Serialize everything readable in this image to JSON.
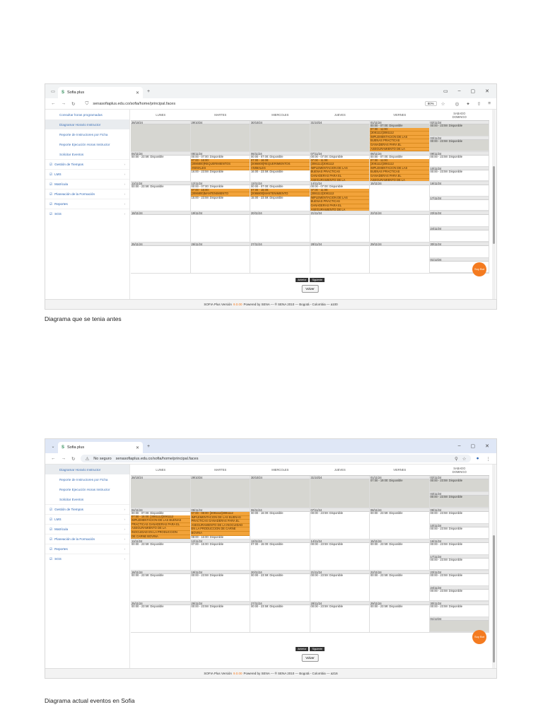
{
  "shot1": {
    "tab_title": "Sofia plus",
    "url": "senasofiaplus.edu.co/sofia/home/principal.faces",
    "zoom": "80%",
    "sidebar_sub": [
      "Consultar horas programadas",
      "Diagramar Horario Instructor",
      "Reporte de Instructores por Ficha",
      "Reporte Ejecución Horas Instructor",
      "Solicitar Eventos"
    ],
    "sidebar_main": [
      "Gestión de Tiempos",
      "LMS",
      "Matrícula",
      "Planeación de la Formación",
      "Reportes",
      "SGS"
    ],
    "headers": [
      "LUNES",
      "MARTES",
      "MIERCOLES",
      "JUEVES",
      "VIERNES",
      "SABADO",
      "DOMINGO"
    ],
    "weeks": [
      {
        "days": [
          {
            "date": "28/10/24",
            "past": true,
            "events": []
          },
          {
            "date": "29/10/24",
            "past": true,
            "events": []
          },
          {
            "date": "30/10/24",
            "past": true,
            "events": []
          },
          {
            "date": "31/10/24",
            "past": true,
            "events": []
          },
          {
            "date": "01/11/24",
            "past": true,
            "events": [
              {
                "t": "00:00 - 07:00: Disponible",
                "o": false
              },
              {
                "t": "07:00 - 11:00:",
                "o": true
              },
              {
                "t": "[3081112]3081112",
                "o": true
              },
              {
                "t": "IMPLEMENTACION DE LAS",
                "o": true
              },
              {
                "t": "BUENAS PRACTICAS",
                "o": true
              },
              {
                "t": "GANADERAS PARA EL",
                "o": true
              },
              {
                "t": "ASEGURAMIENTO DE LA",
                "o": true
              }
            ]
          },
          {
            "sat": {
              "date": "02/11/24",
              "past": true,
              "events": [
                {
                  "t": "00:00 - 23:59: Disponible",
                  "o": false
                }
              ]
            },
            "sun": {
              "date": "03/11/24",
              "past": true,
              "events": [
                {
                  "t": "00:00 - 23:59: Disponible",
                  "o": false
                }
              ]
            }
          }
        ]
      },
      {
        "days": [
          {
            "date": "04/11/24",
            "events": [
              {
                "t": "00:00 - 23:59: Disponible",
                "o": false
              }
            ]
          },
          {
            "date": "05/11/24",
            "events": [
              {
                "t": "00:00 - 07:00: Disponible",
                "o": false
              },
              {
                "t": "07:00 - 16:00:",
                "o": true
              },
              {
                "t": "[3086800]REQUERIMIENTOS",
                "o": true
              },
              {
                "t": "ANIMALES",
                "o": true
              },
              {
                "t": "16:00 - 23:59: Disponible",
                "o": false
              }
            ]
          },
          {
            "date": "06/11/24",
            "events": [
              {
                "t": "00:00 - 07:00: Disponible",
                "o": false
              },
              {
                "t": "07:00 - 16:00:",
                "o": true
              },
              {
                "t": "[3086800]REQUERIMIENTOS",
                "o": true
              },
              {
                "t": "ANIMALES",
                "o": true
              },
              {
                "t": "16:00 - 23:59: Disponible",
                "o": false
              }
            ]
          },
          {
            "date": "07/11/24",
            "events": [
              {
                "t": "00:00 - 07:00: Disponible",
                "o": false
              },
              {
                "t": "07:00 - 11:00:",
                "o": true
              },
              {
                "t": "[3081112]3081112",
                "o": true
              },
              {
                "t": "IMPLEMENTACION DE LAS",
                "o": true
              },
              {
                "t": "BUENAS PRACTICAS",
                "o": true
              },
              {
                "t": "GANADERAS PARA EL",
                "o": true
              },
              {
                "t": "ASEGURAMIENTO DE LA",
                "o": true
              }
            ]
          },
          {
            "date": "08/11/24",
            "events": [
              {
                "t": "00:00 - 07:00: Disponible",
                "o": false
              },
              {
                "t": "07:00 - 11:00:",
                "o": true
              },
              {
                "t": "[3081112]3081112",
                "o": true
              },
              {
                "t": "IMPLEMENTACION DE LAS",
                "o": true
              },
              {
                "t": "BUENAS PRACTICAS",
                "o": true
              },
              {
                "t": "GANADERAS PARA EL",
                "o": true
              },
              {
                "t": "ASEGURAMIENTO DE LA",
                "o": true
              }
            ]
          },
          {
            "sat": {
              "date": "09/11/24",
              "events": [
                {
                  "t": "00:00 - 23:59: Disponible",
                  "o": false
                }
              ]
            },
            "sun": {
              "date": "10/11/24",
              "events": [
                {
                  "t": "00:00 - 23:59: Disponible",
                  "o": false
                }
              ]
            }
          }
        ]
      },
      {
        "days": [
          {
            "date": "11/11/24",
            "events": [
              {
                "t": "00:00 - 23:59: Disponible",
                "o": false
              }
            ]
          },
          {
            "date": "12/11/24",
            "events": [
              {
                "t": "00:00 - 07:00: Disponible",
                "o": false
              },
              {
                "t": "07:00 - 15:00:",
                "o": true
              },
              {
                "t": "[3086800]MANTENIMIENTO",
                "o": true
              },
              {
                "t": "15:00 - 23:59: Disponible",
                "o": false
              }
            ]
          },
          {
            "date": "13/11/24",
            "events": [
              {
                "t": "00:00 - 07:00: Disponible",
                "o": false
              },
              {
                "t": "07:00 - 15:00:",
                "o": true
              },
              {
                "t": "[3086800]MANTENIMIENTO",
                "o": true
              },
              {
                "t": "15:00 - 23:59: Disponible",
                "o": false
              }
            ]
          },
          {
            "date": "14/11/24",
            "events": [
              {
                "t": "00:00 - 07:00: Disponible",
                "o": false
              },
              {
                "t": "07:00 - 11:00:",
                "o": true
              },
              {
                "t": "[3081112]3081112",
                "o": true
              },
              {
                "t": "IMPLEMENTACION DE LAS",
                "o": true
              },
              {
                "t": "BUENAS PRACTICAS",
                "o": true
              },
              {
                "t": "GANADERAS PARA EL",
                "o": true
              },
              {
                "t": "ASEGURAMIENTO DE LA",
                "o": true
              }
            ]
          },
          {
            "date": "15/11/24",
            "events": []
          },
          {
            "sat": {
              "date": "16/11/24",
              "events": []
            },
            "sun": {
              "date": "17/11/24",
              "events": []
            }
          }
        ]
      },
      {
        "days": [
          {
            "date": "18/11/24",
            "events": []
          },
          {
            "date": "19/11/24",
            "events": []
          },
          {
            "date": "20/11/24",
            "events": []
          },
          {
            "date": "21/11/24",
            "events": []
          },
          {
            "date": "22/11/24",
            "events": []
          },
          {
            "sat": {
              "date": "23/11/24",
              "events": []
            },
            "sun": {
              "date": "24/11/24",
              "events": []
            }
          }
        ]
      },
      {
        "days": [
          {
            "date": "25/11/24",
            "events": []
          },
          {
            "date": "26/11/24",
            "events": []
          },
          {
            "date": "27/11/24",
            "events": []
          },
          {
            "date": "28/11/24",
            "events": []
          },
          {
            "date": "29/11/24",
            "events": []
          },
          {
            "sat": {
              "date": "30/11/24",
              "events": []
            },
            "sun": {
              "date": "01/12/24",
              "events": []
            }
          }
        ]
      }
    ],
    "pager_prev": "Anterior",
    "pager_next": "Siguiente",
    "volver": "Volver",
    "chatbot": "Soy Bot",
    "footer_sofia": "SOFIA Plus Versión",
    "footer_ver": "9.0.00",
    "footer_rest": "Powered by SENA --- ® SENA 2010 --- Bogotá - Colombia --- a100"
  },
  "shot2": {
    "tab_title": "Sofia plus",
    "security": "No seguro",
    "url": "senasofiaplus.edu.co/sofia/home/principal.faces",
    "sidebar_sub": [
      "Diagramar Horario Instructor",
      "Reporte de Instructores por Ficha",
      "Reporte Ejecución Horas Instructor",
      "Solicitar Eventos"
    ],
    "sidebar_main": [
      "Gestión de Tiempos",
      "LMS",
      "Matrícula",
      "Planeación de la Formación",
      "Reportes",
      "SGS"
    ],
    "headers": [
      "LUNES",
      "MARTES",
      "MIERCOLES",
      "JUEVES",
      "VIERNES",
      "SABADO",
      "DOMINGO"
    ],
    "weeks": [
      {
        "days": [
          {
            "date": "28/10/24",
            "past": true,
            "events": []
          },
          {
            "date": "29/10/24",
            "past": true,
            "events": []
          },
          {
            "date": "30/10/24",
            "past": true,
            "events": []
          },
          {
            "date": "31/10/24",
            "past": true,
            "events": []
          },
          {
            "date": "01/11/24",
            "past": true,
            "events": [
              {
                "t": "07:00 - 19:00: Disponible",
                "o": false
              }
            ]
          },
          {
            "sat": {
              "date": "02/11/24",
              "past": true,
              "events": [
                {
                  "t": "00:00 - 23:59: Disponible",
                  "o": false
                }
              ]
            },
            "sun": {
              "date": "03/11/24",
              "past": true,
              "events": [
                {
                  "t": "00:00 - 23:59: Disponible",
                  "o": false
                }
              ]
            }
          }
        ]
      },
      {
        "days": [
          {
            "date": "04/11/24",
            "events": [
              {
                "t": "00:00 - 07:00: Disponible",
                "o": false
              },
              {
                "t": "07:00 - 15:00: [3081112]3081112",
                "o": true
              },
              {
                "t": "IMPLEMENTACION DE LAS BUENAS",
                "o": true
              },
              {
                "t": "PRACTICAS GANADERAS PARA EL",
                "o": true
              },
              {
                "t": "ASEGURAMIENTO DE LA",
                "o": true
              },
              {
                "t": "INOCUIDAD EN LA PRODUCCION",
                "o": true
              },
              {
                "t": "DE CARNE BOVINA",
                "o": true
              }
            ]
          },
          {
            "date": "05/11/24",
            "events": [
              {
                "t": "07:00 - 08:00: [3081112]3081112",
                "o": true
              },
              {
                "t": "IMPLEMENTACION DE LAS BUENAS",
                "o": true
              },
              {
                "t": "PRACTICAS GANADERAS PARA EL",
                "o": true
              },
              {
                "t": "ASEGURAMIENTO DE LA INOCUIDAD",
                "o": true
              },
              {
                "t": "EN LA PRODUCCION DE CARNE",
                "o": true
              },
              {
                "t": "BOVINA",
                "o": true
              },
              {
                "t": "08:00 - 16:00: Disponible",
                "o": false
              }
            ]
          },
          {
            "date": "06/11/24",
            "events": [
              {
                "t": "00:00 - 16:00: Disponible",
                "o": false
              }
            ]
          },
          {
            "date": "07/11/24",
            "events": [
              {
                "t": "00:00 - 23:59: Disponible",
                "o": false
              }
            ]
          },
          {
            "date": "08/11/24",
            "events": [
              {
                "t": "00:00 - 23:59: Disponible",
                "o": false
              }
            ]
          },
          {
            "sat": {
              "date": "09/11/24",
              "events": [
                {
                  "t": "00:00 - 23:59: Disponible",
                  "o": false
                }
              ]
            },
            "sun": {
              "date": "10/11/24",
              "events": [
                {
                  "t": "00:00 - 23:59: Disponible",
                  "o": false
                }
              ]
            }
          }
        ]
      },
      {
        "days": [
          {
            "date": "11/11/24",
            "events": [
              {
                "t": "00:00 - 23:59: Disponible",
                "o": false
              }
            ]
          },
          {
            "date": "12/11/24",
            "events": [
              {
                "t": "07:00 - 15:00: Disponible",
                "o": false
              }
            ]
          },
          {
            "date": "13/11/24",
            "events": [
              {
                "t": "07:00 - 15:00: Disponible",
                "o": false
              }
            ]
          },
          {
            "date": "14/11/24",
            "events": [
              {
                "t": "00:00 - 23:59: Disponible",
                "o": false
              }
            ]
          },
          {
            "date": "15/11/24",
            "events": [
              {
                "t": "00:00 - 23:59: Disponible",
                "o": false
              }
            ]
          },
          {
            "sat": {
              "date": "16/11/24",
              "events": [
                {
                  "t": "00:00 - 23:59: Disponible",
                  "o": false
                }
              ]
            },
            "sun": {
              "date": "17/11/24",
              "events": [
                {
                  "t": "00:00 - 23:59: Disponible",
                  "o": false
                }
              ]
            }
          }
        ]
      },
      {
        "days": [
          {
            "date": "18/11/24",
            "events": [
              {
                "t": "00:00 - 23:59: Disponible",
                "o": false
              }
            ]
          },
          {
            "date": "19/11/24",
            "events": [
              {
                "t": "00:00 - 23:59: Disponible",
                "o": false
              }
            ]
          },
          {
            "date": "20/11/24",
            "events": [
              {
                "t": "00:00 - 23:59: Disponible",
                "o": false
              }
            ]
          },
          {
            "date": "21/11/24",
            "events": [
              {
                "t": "00:00 - 23:59: Disponible",
                "o": false
              }
            ]
          },
          {
            "date": "22/11/24",
            "events": [
              {
                "t": "00:00 - 23:59: Disponible",
                "o": false
              }
            ]
          },
          {
            "sat": {
              "date": "23/11/24",
              "events": [
                {
                  "t": "00:00 - 23:59: Disponible",
                  "o": false
                }
              ]
            },
            "sun": {
              "date": "24/11/24",
              "events": [
                {
                  "t": "00:00 - 23:59: Disponible",
                  "o": false
                }
              ]
            }
          }
        ]
      },
      {
        "days": [
          {
            "date": "25/11/24",
            "events": [
              {
                "t": "00:00 - 23:59: Disponible",
                "o": false
              }
            ]
          },
          {
            "date": "26/11/24",
            "events": [
              {
                "t": "00:00 - 23:59: Disponible",
                "o": false
              }
            ]
          },
          {
            "date": "27/11/24",
            "events": [
              {
                "t": "00:00 - 23:59: Disponible",
                "o": false
              }
            ]
          },
          {
            "date": "28/11/24",
            "events": [
              {
                "t": "00:00 - 23:59: Disponible",
                "o": false
              }
            ]
          },
          {
            "date": "29/11/24",
            "events": [
              {
                "t": "00:00 - 23:59: Disponible",
                "o": false
              }
            ]
          },
          {
            "sat": {
              "date": "30/11/24",
              "events": [
                {
                  "t": "00:00 - 23:59: Disponible",
                  "o": false
                }
              ]
            },
            "sun": {
              "date": "01/12/24",
              "past": true,
              "events": []
            }
          }
        ]
      }
    ],
    "pager_prev": "Anterior",
    "pager_next": "Siguiente",
    "volver": "Volver",
    "chatbot": "Soy Bot",
    "footer_sofia": "SOFIA Plus Versión",
    "footer_ver": "9.0.00",
    "footer_rest": "Powered by SENA --- ® SENA 2010 --- Bogotá - Colombia --- a216"
  },
  "captions": {
    "first": "Diagrama que se tenia antes",
    "second": "Diagrama actual eventos en Sofia"
  }
}
